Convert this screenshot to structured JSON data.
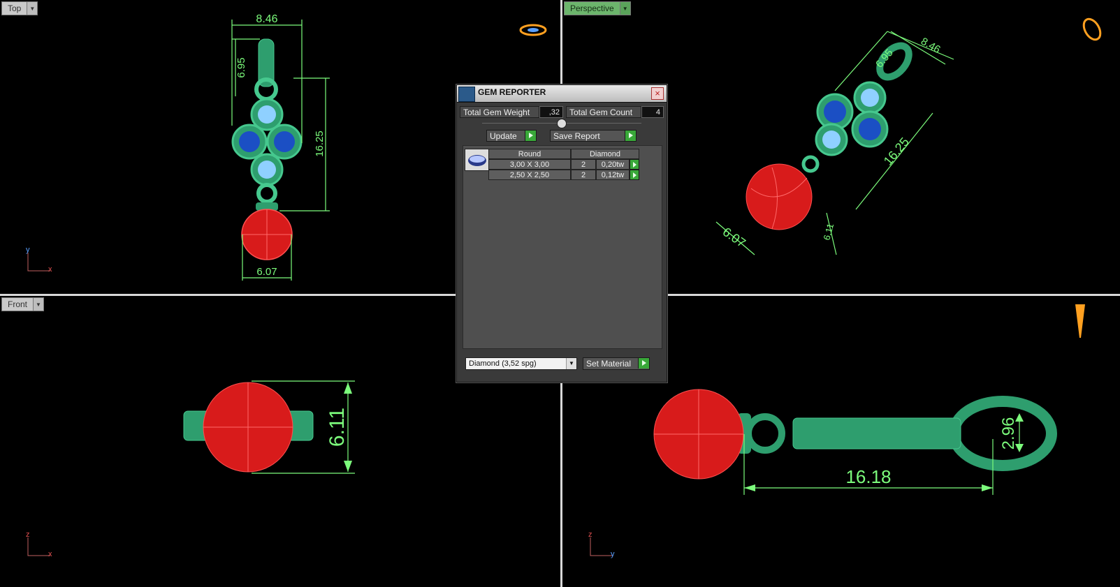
{
  "viewports": {
    "top": {
      "label": "Top",
      "dims": {
        "width": "8.46",
        "bail": "6.95",
        "cluster": "16.25",
        "ball": "6.07"
      },
      "axes": {
        "v": "y",
        "h": "x"
      }
    },
    "perspective": {
      "label": "Perspective",
      "dims": {
        "width": "8.46",
        "bail": "6.95",
        "cluster": "16.25",
        "ball": "6.07",
        "ball_depth": "6.11"
      }
    },
    "front": {
      "label": "Front",
      "dims": {
        "height": "6.11"
      },
      "axes": {
        "v": "z",
        "h": "x"
      }
    },
    "side": {
      "dims": {
        "length": "16.18",
        "ring": "2.96"
      },
      "axes": {
        "v": "z",
        "h": "y"
      }
    }
  },
  "dialog": {
    "title": "GEM REPORTER",
    "total_weight_label": "Total Gem Weight",
    "total_weight_value": ",32",
    "total_count_label": "Total Gem Count",
    "total_count_value": "4",
    "update_label": "Update",
    "save_report_label": "Save Report",
    "table": {
      "shape": "Round",
      "material": "Diamond",
      "rows": [
        {
          "size": "3,00 X 3,00",
          "count": "2",
          "weight": "0,20tw"
        },
        {
          "size": "2,50 X 2,50",
          "count": "2",
          "weight": "0,12tw"
        }
      ]
    },
    "material_select": "Diamond      (3,52 spg)",
    "set_material_label": "Set Material"
  },
  "colors": {
    "dim": "#7CFC7C",
    "metal": "#2e9e6e",
    "ruby": "#d81b1b",
    "gem_blue": "#1b4fc4",
    "gem_light": "#8fd0ff"
  }
}
